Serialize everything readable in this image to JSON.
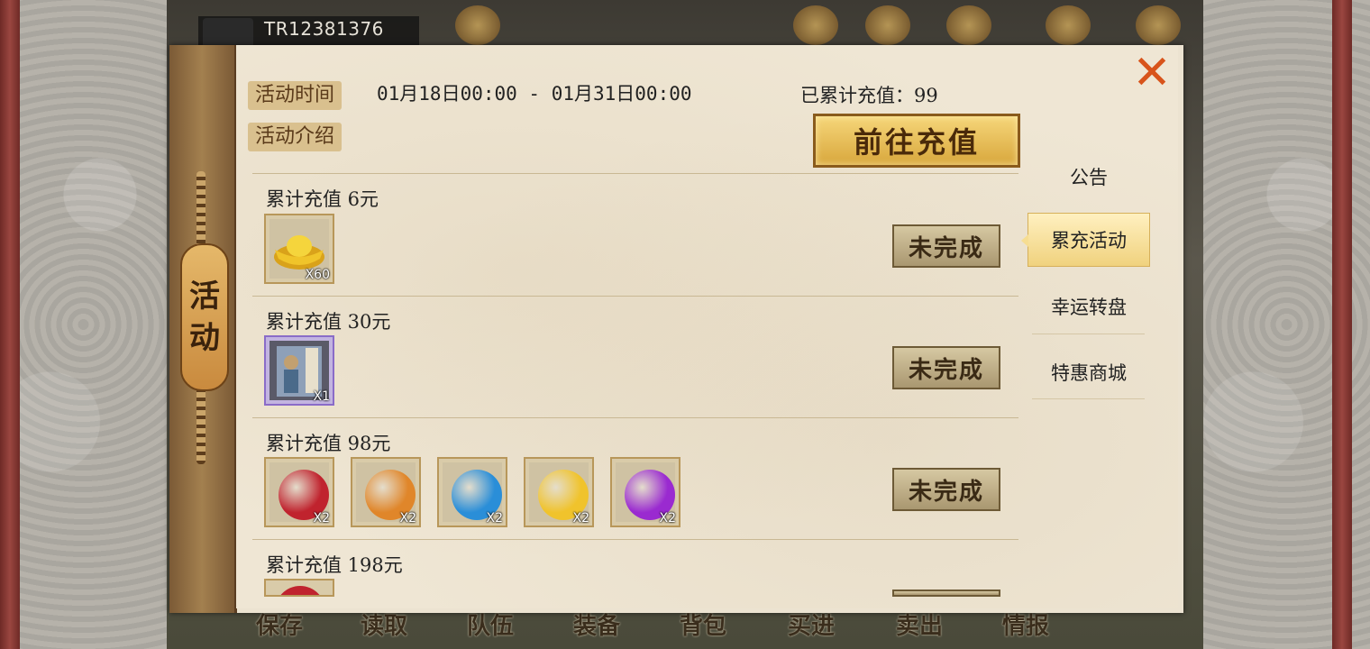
{
  "player": {
    "id": "TR12381376"
  },
  "bottom_menu": [
    {
      "label": "保存"
    },
    {
      "label": "读取"
    },
    {
      "label": "队伍"
    },
    {
      "label": "装备"
    },
    {
      "label": "背包"
    },
    {
      "label": "买进"
    },
    {
      "label": "卖出"
    },
    {
      "label": "情报"
    }
  ],
  "panel": {
    "side_title": [
      "活",
      "动"
    ],
    "activity_time_label": "活动时间",
    "activity_time_value": "01月18日00:00 - 01月31日00:00",
    "activity_intro_label": "活动介绍",
    "total_recharge": "已累计充值：99",
    "go_recharge_button": "前往充值",
    "close_icon": "close-icon"
  },
  "tiers": [
    {
      "title": "累计充值 6元",
      "status": "未完成",
      "rewards": [
        {
          "icon": "gold-ingot-icon",
          "qty": "X60"
        }
      ]
    },
    {
      "title": "累计充值 30元",
      "status": "未完成",
      "rewards": [
        {
          "icon": "hero-card-icon",
          "qty": "X1"
        }
      ]
    },
    {
      "title": "累计充值 98元",
      "status": "未完成",
      "rewards": [
        {
          "icon": "red-pomegranate-icon",
          "qty": "X2",
          "color": "#c0232e"
        },
        {
          "icon": "orange-gourd-icon",
          "qty": "X2",
          "color": "#e0862a"
        },
        {
          "icon": "blue-radish-icon",
          "qty": "X2",
          "color": "#2a8ed8"
        },
        {
          "icon": "yellow-peach-icon",
          "qty": "X2",
          "color": "#f0c32c"
        },
        {
          "icon": "purple-fruit-icon",
          "qty": "X2",
          "color": "#9a2ad0"
        }
      ]
    },
    {
      "title": "累计充值 198元",
      "status": "",
      "rewards": [
        {
          "icon": "red-pomegranate-icon",
          "qty": "",
          "color": "#c0232e"
        }
      ]
    }
  ],
  "tabs": [
    {
      "label": "公告",
      "active": false
    },
    {
      "label": "累充活动",
      "active": true
    },
    {
      "label": "幸运转盘",
      "active": false
    },
    {
      "label": "特惠商城",
      "active": false
    }
  ]
}
